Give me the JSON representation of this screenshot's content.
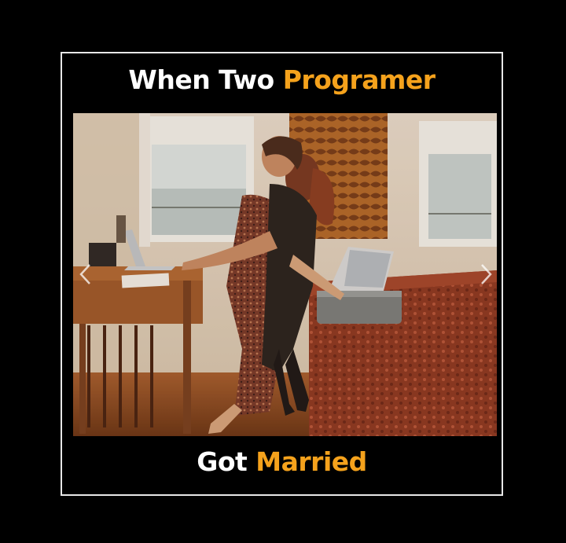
{
  "top_caption": {
    "white_part": "When Two",
    "orange_part": "Programer"
  },
  "bottom_caption": {
    "white_part": "Got",
    "orange_part": "Married"
  },
  "colors": {
    "background": "#000000",
    "frame_border": "#e8e8e8",
    "caption_white": "#ffffff",
    "caption_orange": "#f5a21c"
  },
  "photo": {
    "icons": [
      "chevron-left-icon",
      "chevron-right-icon"
    ]
  }
}
